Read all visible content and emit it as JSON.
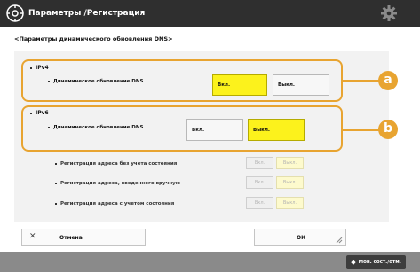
{
  "header": {
    "title": "Параметры /Регистрация"
  },
  "page": {
    "subtitle": "<Параметры динамического обновления DNS>"
  },
  "ipv4": {
    "label": "IPv4",
    "option_label": "Динамическое обновление DNS",
    "on_label": "Вкл.",
    "off_label": "Выкл.",
    "selected": "on"
  },
  "ipv6": {
    "label": "IPv6",
    "option_label": "Динамическое обновление DNS",
    "on_label": "Вкл.",
    "off_label": "Выкл.",
    "selected": "off"
  },
  "callouts": {
    "a": "a",
    "b": "b"
  },
  "sub_options": [
    {
      "label": "Регистрация адреса без учета состояния",
      "on_label": "Вкл.",
      "off_label": "Выкл."
    },
    {
      "label": "Регистрация адреса, введенного вручную",
      "on_label": "Вкл.",
      "off_label": "Выкл."
    },
    {
      "label": "Регистрация адреса с учетом состояния",
      "on_label": "Вкл.",
      "off_label": "Выкл."
    }
  ],
  "buttons": {
    "cancel": "Отмена",
    "ok": "ОК"
  },
  "footer": {
    "status_monitor": "Мон. сост./отм."
  },
  "colors": {
    "accent": "#e8a431",
    "selected": "#fcf21c",
    "header": "#2f2f2f"
  }
}
